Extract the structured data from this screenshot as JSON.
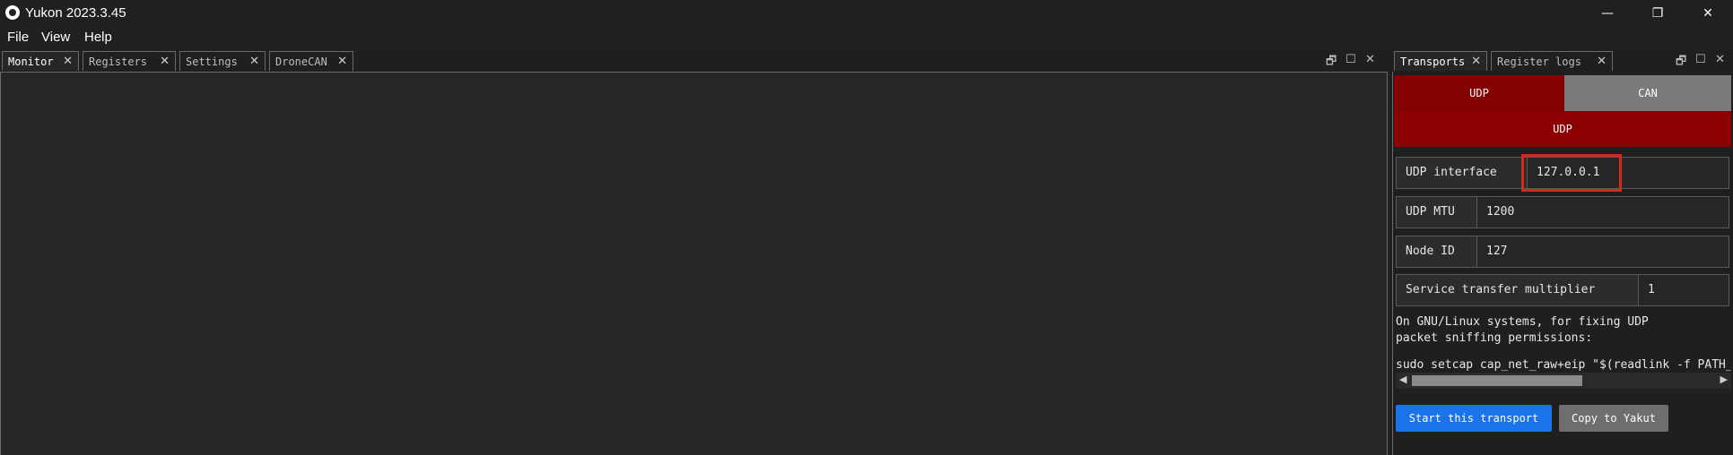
{
  "window": {
    "title": "Yukon 2023.3.45",
    "controls": {
      "minimize": "—",
      "restore": "❐",
      "close": "✕"
    }
  },
  "menu": {
    "items": [
      "File",
      "View",
      "Help"
    ]
  },
  "left_pane": {
    "tabs": [
      {
        "label": "Monitor",
        "active": true
      },
      {
        "label": "Registers",
        "active": false
      },
      {
        "label": "Settings",
        "active": false
      },
      {
        "label": "DroneCAN",
        "active": false
      }
    ],
    "icons": {
      "float": "🗗",
      "maximize": "☐",
      "close": "✕"
    }
  },
  "right_pane": {
    "tabs": [
      {
        "label": "Transports",
        "active": true
      },
      {
        "label": "Register logs",
        "active": false
      }
    ],
    "icons": {
      "float": "🗗",
      "maximize": "☐",
      "close": "✕"
    },
    "transport_toggle": {
      "options": [
        "UDP",
        "CAN"
      ],
      "selected": "UDP",
      "selected_label": "UDP"
    },
    "fields": [
      {
        "label": "UDP interface",
        "value": "127.0.0.1"
      },
      {
        "label": "UDP MTU",
        "value": "1200"
      },
      {
        "label": "Node ID",
        "value": "127"
      },
      {
        "label": "Service transfer multiplier",
        "value": "1"
      }
    ],
    "note_line1": "On GNU/Linux systems, for fixing UDP",
    "note_line2": "packet sniffing permissions:",
    "command": "sudo setcap cap_net_raw+eip \"$(readlink -f PATH_",
    "buttons": {
      "start": "Start this transport",
      "copy": "Copy to Yakut"
    }
  },
  "colors": {
    "accent_red": "#850000",
    "accent_blue": "#1a73e8",
    "highlight": "#d42a1c"
  }
}
